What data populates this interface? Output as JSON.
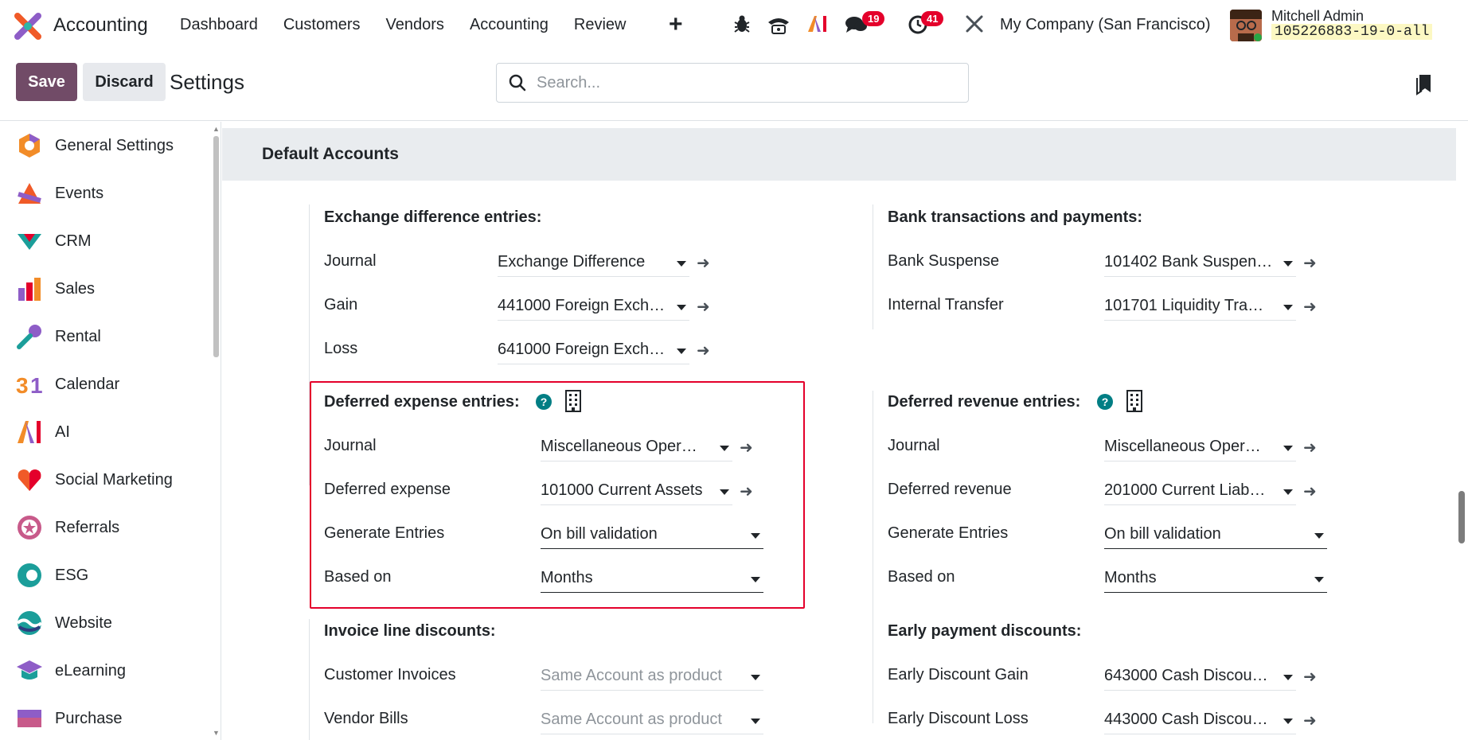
{
  "topbar": {
    "app_name": "Accounting",
    "menu": [
      "Dashboard",
      "Customers",
      "Vendors",
      "Accounting",
      "Review"
    ],
    "chat_badge": "19",
    "activity_badge": "41",
    "company": "My Company (San Francisco)",
    "user_name": "Mitchell Admin",
    "db_name": "105226883-19-0-all"
  },
  "actionbar": {
    "save_label": "Save",
    "discard_label": "Discard",
    "page_title": "Settings",
    "search_placeholder": "Search..."
  },
  "sidebar": {
    "items": [
      {
        "label": "General Settings",
        "icon": "general-settings-icon"
      },
      {
        "label": "Events",
        "icon": "events-icon"
      },
      {
        "label": "CRM",
        "icon": "crm-icon"
      },
      {
        "label": "Sales",
        "icon": "sales-icon"
      },
      {
        "label": "Rental",
        "icon": "rental-icon"
      },
      {
        "label": "Calendar",
        "icon": "calendar-icon"
      },
      {
        "label": "AI",
        "icon": "ai-icon"
      },
      {
        "label": "Social Marketing",
        "icon": "social-marketing-icon"
      },
      {
        "label": "Referrals",
        "icon": "referrals-icon"
      },
      {
        "label": "ESG",
        "icon": "esg-icon"
      },
      {
        "label": "Website",
        "icon": "website-icon"
      },
      {
        "label": "eLearning",
        "icon": "elearning-icon"
      },
      {
        "label": "Purchase",
        "icon": "purchase-icon"
      }
    ]
  },
  "section_title": "Default Accounts",
  "exchange": {
    "title": "Exchange difference entries:",
    "journal_label": "Journal",
    "journal_value": "Exchange Difference",
    "gain_label": "Gain",
    "gain_value": "441000 Foreign Exch…",
    "loss_label": "Loss",
    "loss_value": "641000 Foreign Exch…"
  },
  "bank": {
    "title": "Bank transactions and payments:",
    "suspense_label": "Bank Suspense",
    "suspense_value": "101402 Bank Suspen…",
    "transfer_label": "Internal Transfer",
    "transfer_value": "101701 Liquidity Tra…"
  },
  "deferred_expense": {
    "title": "Deferred expense entries:",
    "journal_label": "Journal",
    "journal_value": "Miscellaneous Oper…",
    "account_label": "Deferred expense",
    "account_value": "101000 Current Assets",
    "generate_label": "Generate Entries",
    "generate_value": "On bill validation",
    "based_label": "Based on",
    "based_value": "Months"
  },
  "deferred_revenue": {
    "title": "Deferred revenue entries:",
    "journal_label": "Journal",
    "journal_value": "Miscellaneous Oper…",
    "account_label": "Deferred revenue",
    "account_value": "201000 Current Liab…",
    "generate_label": "Generate Entries",
    "generate_value": "On bill validation",
    "based_label": "Based on",
    "based_value": "Months"
  },
  "invoice_discounts": {
    "title": "Invoice line discounts:",
    "customer_label": "Customer Invoices",
    "customer_value": "Same Account as product",
    "vendor_label": "Vendor Bills",
    "vendor_value": "Same Account as product"
  },
  "early_payment": {
    "title": "Early payment discounts:",
    "gain_label": "Early Discount Gain",
    "gain_value": "643000 Cash Discou…",
    "loss_label": "Early Discount Loss",
    "loss_value": "443000 Cash Discou…"
  },
  "colors": {
    "brand": "#714b67",
    "help": "#017e84",
    "highlight_box": "#e4002b",
    "badge": "#e4002b"
  }
}
